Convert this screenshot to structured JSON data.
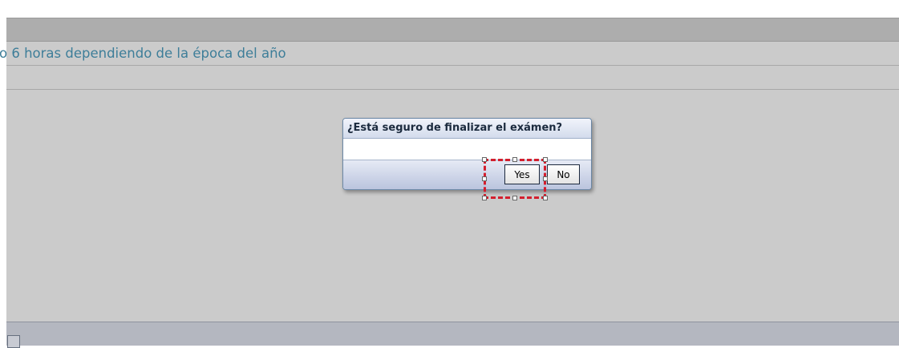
{
  "page": {
    "question_text": "o 6 horas dependiendo de la época del año"
  },
  "dialog": {
    "title": "¿Está seguro de finalizar el exámen?",
    "yes_label": "Yes",
    "no_label": "No"
  },
  "colors": {
    "background": "#cbcbcb",
    "header_bar": "#adadad",
    "question_text": "#3e7e99",
    "selection_highlight": "#d31f2e",
    "footer_bar": "#b4b7c0"
  }
}
